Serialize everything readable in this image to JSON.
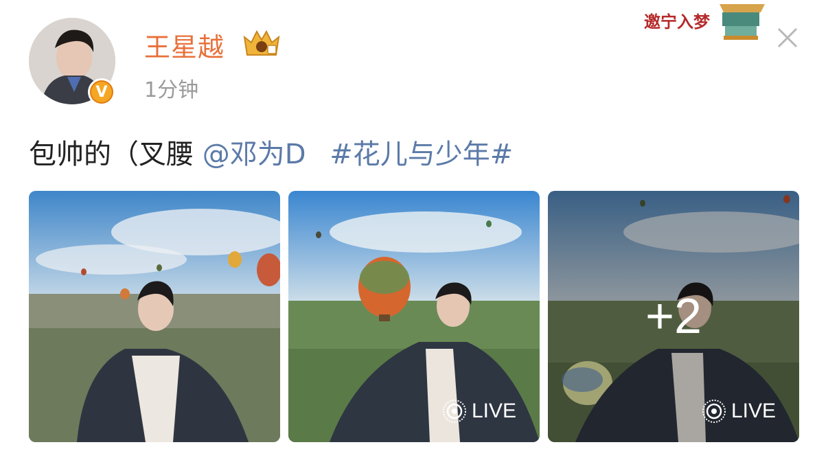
{
  "post": {
    "username": "王星越",
    "timestamp": "1分钟",
    "text_prefix": "包帅的（叉腰",
    "mention": "@邓为D",
    "topic": "#花儿与少年#"
  },
  "icons": {
    "avatar": "avatar",
    "verified": "verified-badge-icon",
    "crown": "crown-icon",
    "close": "close-icon",
    "live": "live-icon"
  },
  "decoration": {
    "text": "邀宁入梦"
  },
  "photos": [
    {
      "live_label": ""
    },
    {
      "live_label": "LIVE"
    },
    {
      "live_label": "LIVE",
      "more_count": "+2"
    }
  ],
  "colors": {
    "username": "#e8703a",
    "link": "#5b7aa8",
    "timestamp": "#9a9a9a",
    "text": "#222222"
  }
}
